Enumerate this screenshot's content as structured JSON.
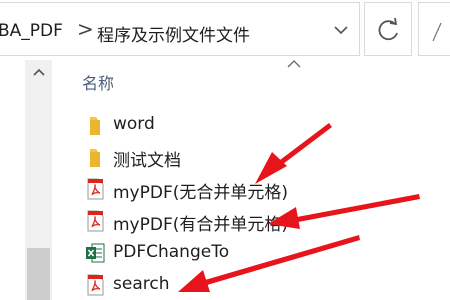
{
  "address_bar": {
    "crumb_1": "BA_PDF",
    "separator": ">",
    "crumb_2": "程序及示例文件文件"
  },
  "file_list": {
    "column_name": "名称",
    "items": [
      {
        "name": "word",
        "type": "folder"
      },
      {
        "name": "测试文档",
        "type": "folder"
      },
      {
        "name": "myPDF(无合并单元格)",
        "type": "pdf"
      },
      {
        "name": "myPDF(有合并单元格)",
        "type": "pdf"
      },
      {
        "name": "PDFChangeTo",
        "type": "excel"
      },
      {
        "name": "search",
        "type": "pdf"
      }
    ]
  },
  "colors": {
    "annotation_arrow": "#e8141b",
    "folder": "#f5c443",
    "pdf_red": "#d9261c",
    "excel_green": "#1e7145",
    "header_text": "#4b5e7a"
  },
  "icons": {
    "dropdown": "chevron-down-icon",
    "refresh": "refresh-icon",
    "scroll_up": "scroll-up-icon",
    "sort": "sort-up-icon"
  }
}
